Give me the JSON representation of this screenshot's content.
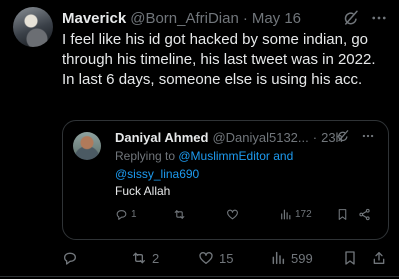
{
  "tweet": {
    "author_name": "Maverick",
    "author_handle": "@Born_AfriDian",
    "separator": "·",
    "date": "May 16",
    "text_lines": [
      "I feel like his id got hacked by some indian, go through his timeline, his last tweet was in 2022.",
      "In last 6 days, someone else is using his acc."
    ],
    "stats": {
      "replies": "",
      "retweets": "2",
      "likes": "15",
      "views": "599"
    }
  },
  "quoted": {
    "author_name": "Daniyal Ahmed",
    "author_handle": "@Daniyal5132...",
    "separator": "·",
    "time": "23h",
    "replying_prefix": "Replying to ",
    "mention_1": "@MuslimmEditor",
    "and_word": " and",
    "mention_2": "@sissy_lina690",
    "text": "Fuck Allah",
    "stats": {
      "replies": "1",
      "retweets": "",
      "likes": "",
      "views": "172"
    }
  },
  "colors": {
    "background": "#000000",
    "text": "#e7e9ea",
    "muted": "#71767b",
    "accent": "#1d9bf0",
    "border": "#2f3336"
  },
  "icons": [
    "grok-icon",
    "more-icon",
    "reply-icon",
    "retweet-icon",
    "like-icon",
    "views-icon",
    "bookmark-icon",
    "share-icon"
  ]
}
